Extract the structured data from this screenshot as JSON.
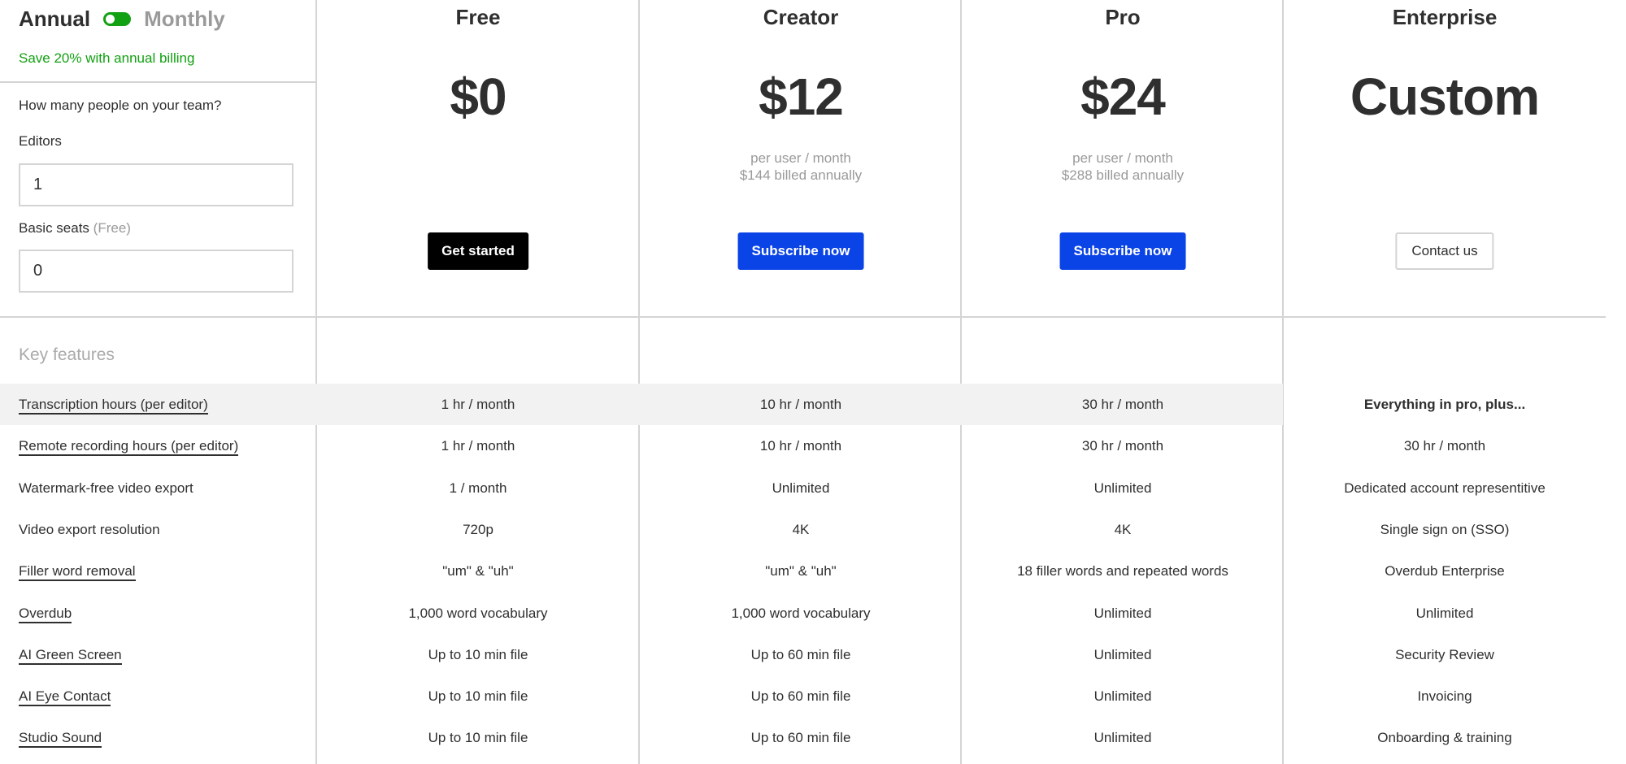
{
  "billing": {
    "annual_label": "Annual",
    "monthly_label": "Monthly",
    "toggle_state": "annual",
    "toggle_color": "#12a112",
    "save_note": "Save 20% with annual billing"
  },
  "team": {
    "question": "How many people on your team?",
    "editors_label": "Editors",
    "editors_value": "1",
    "basic_label": "Basic seats",
    "basic_note": "(Free)",
    "basic_value": "0"
  },
  "plans": [
    {
      "name": "Free",
      "price": "$0",
      "sub1": "",
      "sub2": "",
      "cta": "Get started",
      "cta_style": "black"
    },
    {
      "name": "Creator",
      "price": "$12",
      "sub1": "per user / month",
      "sub2": "$144 billed annually",
      "cta": "Subscribe now",
      "cta_style": "blue"
    },
    {
      "name": "Pro",
      "price": "$24",
      "sub1": "per user / month",
      "sub2": "$288 billed annually",
      "cta": "Subscribe now",
      "cta_style": "blue"
    },
    {
      "name": "Enterprise",
      "price": "Custom",
      "sub1": "",
      "sub2": "",
      "cta": "Contact us",
      "cta_style": "outline"
    }
  ],
  "colors": {
    "accent_blue": "#0b44e6",
    "accent_green": "#12a112",
    "highlight_row": "#f2f2f2"
  },
  "features": {
    "title": "Key features",
    "rows": [
      {
        "name": "Transcription hours (per editor)",
        "underlined": true,
        "highlighted": true,
        "values": [
          "1 hr / month",
          "10 hr / month",
          "30 hr / month",
          "Everything in pro, plus..."
        ]
      },
      {
        "name": "Remote recording hours (per editor)",
        "underlined": true,
        "highlighted": false,
        "values": [
          "1 hr / month",
          "10 hr / month",
          "30 hr / month",
          "30 hr / month"
        ]
      },
      {
        "name": "Watermark-free video export",
        "underlined": false,
        "highlighted": false,
        "values": [
          "1 / month",
          "Unlimited",
          "Unlimited",
          "Dedicated account representitive"
        ]
      },
      {
        "name": "Video export resolution",
        "underlined": false,
        "highlighted": false,
        "values": [
          "720p",
          "4K",
          "4K",
          "Single sign on (SSO)"
        ]
      },
      {
        "name": "Filler word removal",
        "underlined": true,
        "highlighted": false,
        "values": [
          "\"um\" & \"uh\"",
          "\"um\" & \"uh\"",
          "18 filler words and repeated words",
          "Overdub Enterprise"
        ]
      },
      {
        "name": "Overdub",
        "underlined": true,
        "highlighted": false,
        "values": [
          "1,000 word vocabulary",
          "1,000 word vocabulary",
          "Unlimited",
          "Unlimited"
        ]
      },
      {
        "name": "AI Green Screen",
        "underlined": true,
        "highlighted": false,
        "values": [
          "Up to 10 min file",
          "Up to 60 min file",
          "Unlimited",
          "Security Review"
        ]
      },
      {
        "name": "AI Eye Contact",
        "underlined": true,
        "highlighted": false,
        "values": [
          "Up to 10 min file",
          "Up to 60 min file",
          "Unlimited",
          "Invoicing"
        ]
      },
      {
        "name": "Studio Sound",
        "underlined": true,
        "highlighted": false,
        "values": [
          "Up to 10 min file",
          "Up to 60 min file",
          "Unlimited",
          "Onboarding & training"
        ]
      }
    ]
  }
}
